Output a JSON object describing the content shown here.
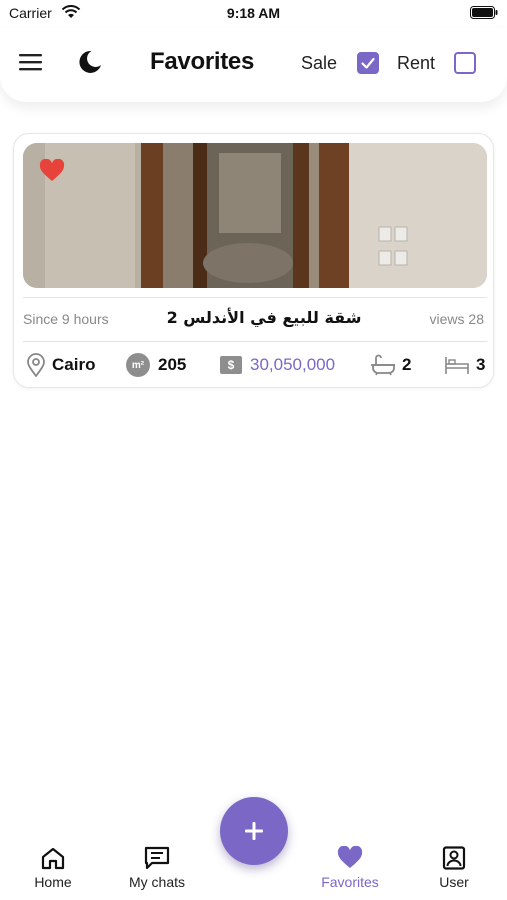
{
  "status_bar": {
    "carrier": "Carrier",
    "time": "9:18 AM"
  },
  "header": {
    "title": "Favorites",
    "filters": [
      {
        "label": "Sale",
        "checked": true
      },
      {
        "label": "Rent",
        "checked": false
      }
    ],
    "icons": {
      "menu": "hamburger-icon",
      "theme": "moon-icon"
    }
  },
  "listing": {
    "favorited": true,
    "posted": "Since 9 hours",
    "title": "شقة للبيع في الأندلس 2",
    "views": "views 28",
    "city": "Cairo",
    "area": "205",
    "area_unit_icon": "m²",
    "price": "30,050,000",
    "currency_icon": "$",
    "bathrooms": "2",
    "bedrooms": "3"
  },
  "fab": {
    "icon": "plus-icon"
  },
  "bottom_nav": {
    "items": [
      {
        "label": "Home",
        "icon": "home-icon",
        "active": false
      },
      {
        "label": "My chats",
        "icon": "chat-icon",
        "active": false
      },
      {
        "label": "Favorites",
        "icon": "heart-icon",
        "active": true
      },
      {
        "label": "User",
        "icon": "user-icon",
        "active": false
      }
    ]
  },
  "colors": {
    "accent": "#7b68c6",
    "heart": "#e8433a",
    "muted": "#888888"
  }
}
